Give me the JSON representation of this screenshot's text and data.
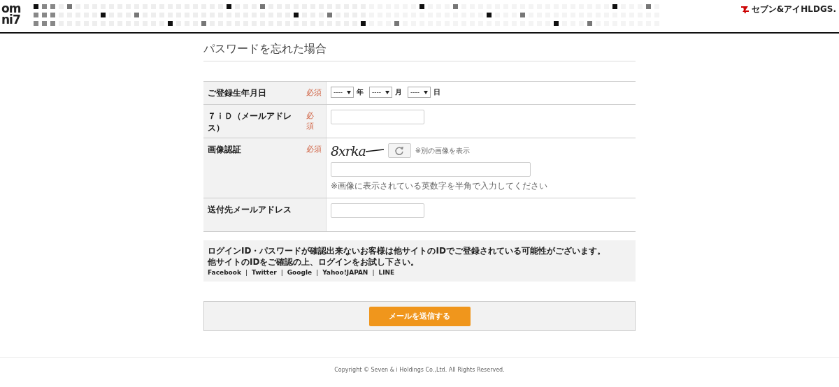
{
  "header": {
    "logo_lines": [
      "om",
      "ni7"
    ],
    "brand": "セブン&アイHLDGS."
  },
  "title": "パスワードを忘れた場合",
  "form": [
    {
      "kind": "date",
      "label": "ご登録生年月日",
      "required_text": "必須",
      "selects": [
        {
          "value": "----",
          "unit": "年"
        },
        {
          "value": "----",
          "unit": "月"
        },
        {
          "value": "----",
          "unit": "日"
        }
      ]
    },
    {
      "kind": "input",
      "label": "７ｉＤ（メールアドレス）",
      "required_text": "必須"
    },
    {
      "kind": "captcha",
      "label": "画像認証",
      "required_text": "必須",
      "captcha": "8xrka",
      "refresh_link": "※別の画像を表示",
      "hint": "※画像に表示されている英数字を半角で入力してください"
    },
    {
      "kind": "input",
      "label": "送付先メールアドレス"
    }
  ],
  "notice": {
    "lines": [
      "ログインID・パスワードが確認出来ないお客様は他サイトのIDでご登録されている可能性がございます。",
      "他サイトのIDをご確認の上、ログインをお試し下さい。"
    ],
    "links": [
      "Facebook",
      "Twitter",
      "Google",
      "Yahoo!JAPAN",
      "LINE"
    ],
    "separator": "|"
  },
  "submit": "メールを送信する",
  "footer": "Copyright © Seven & i Holdings Co.,Ltd. All Rights Reserved."
}
